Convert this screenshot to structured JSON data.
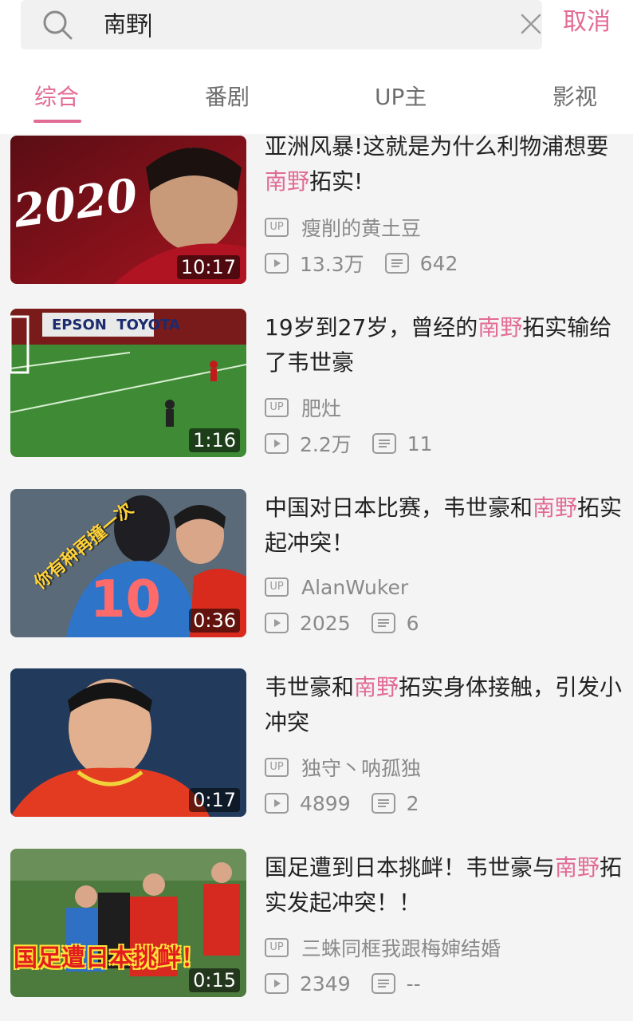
{
  "search": {
    "query": "南野",
    "cancel_label": "取消"
  },
  "tabs": [
    {
      "label": "综合",
      "active": true
    },
    {
      "label": "番剧",
      "active": false
    },
    {
      "label": "UP主",
      "active": false
    },
    {
      "label": "影视",
      "active": false
    }
  ],
  "colors": {
    "accent": "#e26b95",
    "text": "#222222",
    "muted": "#8a8a8a",
    "background": "#f4f4f4"
  },
  "icons": {
    "search": "search-icon",
    "clear": "close-icon",
    "up_badge": "up-badge-icon",
    "play": "play-icon",
    "danmaku": "danmaku-icon"
  },
  "results": [
    {
      "title_before": "亚洲风暴!这就是为什么利物浦想要",
      "title_highlight": "南野",
      "title_after": "拓实!",
      "thumbnail_text": "2020",
      "duration": "10:17",
      "uploader": "瘦削的黄土豆",
      "views": "13.3万",
      "comments": "642"
    },
    {
      "title_before": "19岁到27岁，曾经的",
      "title_highlight": "南野",
      "title_after": "拓实输给了韦世豪",
      "thumbnail_text": "EPSON  TOYOTA",
      "duration": "1:16",
      "uploader": "肥灶",
      "views": "2.2万",
      "comments": "11"
    },
    {
      "title_before": "中国对日本比赛，韦世豪和",
      "title_highlight": "南野",
      "title_after": "拓实起冲突！",
      "thumbnail_text": "你有种再撞一次",
      "duration": "0:36",
      "uploader": "AlanWuker",
      "views": "2025",
      "comments": "6"
    },
    {
      "title_before": "韦世豪和",
      "title_highlight": "南野",
      "title_after": "拓实身体接触，引发小冲突",
      "thumbnail_text": "",
      "duration": "0:17",
      "uploader": "独守丶呐孤独",
      "views": "4899",
      "comments": "2"
    },
    {
      "title_before": "国足遭到日本挑衅！韦世豪与",
      "title_highlight": "南野",
      "title_after": "拓实发起冲突！！",
      "thumbnail_text": "国足遭日本挑衅！",
      "duration": "0:15",
      "uploader": "三蛛同框我跟梅婶结婚",
      "views": "2349",
      "comments": "--"
    }
  ]
}
